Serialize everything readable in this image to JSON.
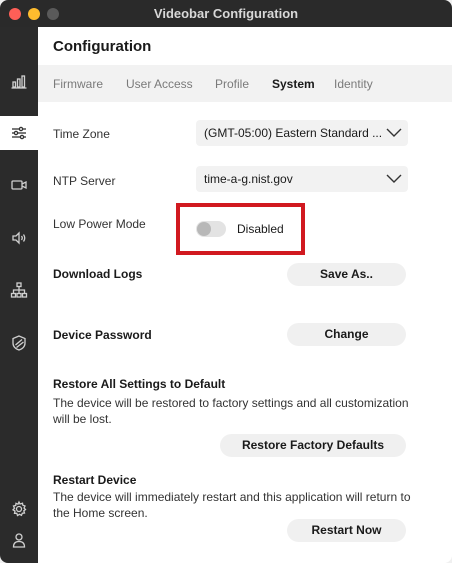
{
  "window": {
    "title": "Videobar Configuration"
  },
  "page": {
    "title": "Configuration"
  },
  "tabs": [
    {
      "label": "Firmware"
    },
    {
      "label": "User Access"
    },
    {
      "label": "Profile"
    },
    {
      "label": "System"
    },
    {
      "label": "Identity"
    }
  ],
  "active_tab": "System",
  "settings": {
    "time_zone": {
      "label": "Time Zone",
      "value": "(GMT-05:00) Eastern Standard ..."
    },
    "ntp_server": {
      "label": "NTP Server",
      "value": "time-a-g.nist.gov"
    },
    "low_power": {
      "label": "Low Power Mode",
      "state_text": "Disabled",
      "enabled": false
    },
    "download_logs": {
      "label": "Download Logs",
      "button": "Save As.."
    },
    "device_password": {
      "label": "Device Password",
      "button": "Change"
    },
    "restore": {
      "title": "Restore All Settings to Default",
      "description": "The device will be restored to factory settings and all customization will be lost.",
      "button": "Restore Factory Defaults"
    },
    "restart": {
      "title": "Restart Device",
      "description": "The device will immediately restart and this application will return to the Home screen.",
      "button": "Restart Now"
    }
  },
  "sidebar": {
    "items": [
      {
        "icon": "bar-chart-icon"
      },
      {
        "icon": "sliders-icon",
        "active": true
      },
      {
        "icon": "camera-icon"
      },
      {
        "icon": "speaker-icon"
      },
      {
        "icon": "network-icon"
      },
      {
        "icon": "shield-icon"
      },
      {
        "icon": "gear-icon"
      },
      {
        "icon": "user-icon"
      }
    ]
  },
  "colors": {
    "highlight": "#d11920",
    "sidebar": "#2b2b2b",
    "titlebar": "#2a2a2a"
  }
}
